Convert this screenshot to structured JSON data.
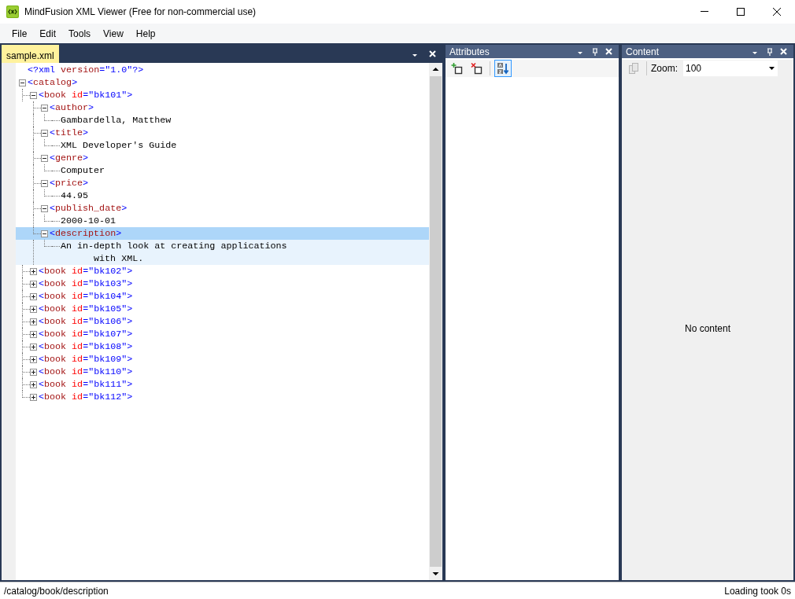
{
  "window": {
    "title": "MindFusion XML Viewer (Free for non-commercial use)"
  },
  "menu": [
    "File",
    "Edit",
    "Tools",
    "View",
    "Help"
  ],
  "document_tab": {
    "label": "sample.xml",
    "selected": true
  },
  "tree": [
    {
      "kind": "declaration",
      "text": "<?xml version=\"1.0\"?>"
    },
    {
      "kind": "element",
      "text": "<catalog>",
      "expanded": true,
      "selected": false,
      "children": [
        {
          "kind": "element",
          "text": "<book id=\"bk101\">",
          "expanded": true,
          "selected": false,
          "children": [
            {
              "kind": "element",
              "text": "<author>",
              "expanded": true,
              "selected": false,
              "children": [
                {
                  "kind": "text",
                  "text": "Gambardella, Matthew"
                }
              ]
            },
            {
              "kind": "element",
              "text": "<title>",
              "expanded": true,
              "selected": false,
              "children": [
                {
                  "kind": "text",
                  "text": "XML Developer's Guide"
                }
              ]
            },
            {
              "kind": "element",
              "text": "<genre>",
              "expanded": true,
              "selected": false,
              "children": [
                {
                  "kind": "text",
                  "text": "Computer"
                }
              ]
            },
            {
              "kind": "element",
              "text": "<price>",
              "expanded": true,
              "selected": false,
              "children": [
                {
                  "kind": "text",
                  "text": "44.95"
                }
              ]
            },
            {
              "kind": "element",
              "text": "<publish_date>",
              "expanded": true,
              "selected": false,
              "children": [
                {
                  "kind": "text",
                  "text": "2000-10-01"
                }
              ]
            },
            {
              "kind": "element",
              "text": "<description>",
              "expanded": true,
              "selected": true,
              "children": [
                {
                  "kind": "text",
                  "text": "An in-depth look at creating applications\n      with XML."
                }
              ]
            }
          ]
        },
        {
          "kind": "element",
          "text": "<book id=\"bk102\">",
          "expanded": false,
          "selected": false
        },
        {
          "kind": "element",
          "text": "<book id=\"bk103\">",
          "expanded": false,
          "selected": false
        },
        {
          "kind": "element",
          "text": "<book id=\"bk104\">",
          "expanded": false,
          "selected": false
        },
        {
          "kind": "element",
          "text": "<book id=\"bk105\">",
          "expanded": false,
          "selected": false
        },
        {
          "kind": "element",
          "text": "<book id=\"bk106\">",
          "expanded": false,
          "selected": false
        },
        {
          "kind": "element",
          "text": "<book id=\"bk107\">",
          "expanded": false,
          "selected": false
        },
        {
          "kind": "element",
          "text": "<book id=\"bk108\">",
          "expanded": false,
          "selected": false
        },
        {
          "kind": "element",
          "text": "<book id=\"bk109\">",
          "expanded": false,
          "selected": false
        },
        {
          "kind": "element",
          "text": "<book id=\"bk110\">",
          "expanded": false,
          "selected": false
        },
        {
          "kind": "element",
          "text": "<book id=\"bk111\">",
          "expanded": false,
          "selected": false
        },
        {
          "kind": "element",
          "text": "<book id=\"bk112\">",
          "expanded": false,
          "selected": false
        }
      ]
    }
  ],
  "attributes_panel": {
    "title": "Attributes",
    "sort_button": {
      "selected": true
    }
  },
  "content_panel": {
    "title": "Content",
    "zoom_label": "Zoom:",
    "zoom_value": "100",
    "message": "No content"
  },
  "status_bar": {
    "path": "/catalog/book/description",
    "message": "Loading took 0s"
  }
}
